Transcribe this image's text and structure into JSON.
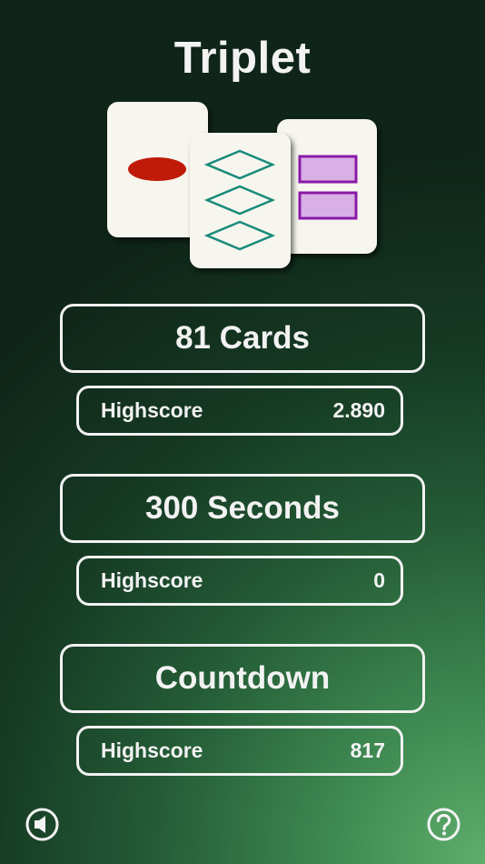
{
  "app": {
    "title": "Triplet"
  },
  "logo_cards": [
    {
      "shape": "oval",
      "count": 1,
      "color": "#c01a08",
      "fill": "solid"
    },
    {
      "shape": "diamond",
      "count": 3,
      "color": "#1a8a7a",
      "fill": "open"
    },
    {
      "shape": "rectangle",
      "count": 2,
      "color": "#8a1aa8",
      "fill": "shaded"
    }
  ],
  "modes": [
    {
      "label": "81 Cards",
      "highscore_label": "Highscore",
      "highscore_value": "2.890"
    },
    {
      "label": "300 Seconds",
      "highscore_label": "Highscore",
      "highscore_value": "0"
    },
    {
      "label": "Countdown",
      "highscore_label": "Highscore",
      "highscore_value": "817"
    }
  ],
  "footer": {
    "sound_icon": "speaker-icon",
    "help_icon": "question-mark-icon"
  },
  "colors": {
    "text": "#f2f2f2",
    "card_face": "#f6f6ee",
    "background_dark": "#0f2519",
    "background_light": "#5fae6c"
  }
}
